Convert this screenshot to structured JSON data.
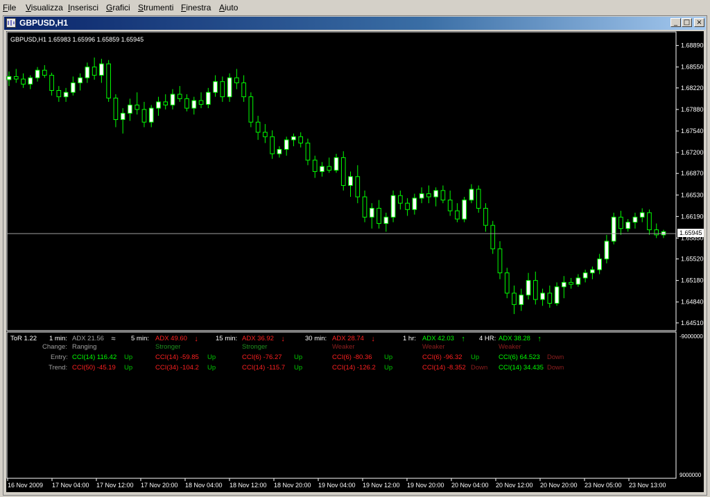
{
  "menu": {
    "items": [
      {
        "label": "File",
        "u": "F",
        "rest": "ile"
      },
      {
        "label": "Visualizza",
        "u": "V",
        "rest": "isualizza"
      },
      {
        "label": "Inserisci",
        "u": "I",
        "rest": "nserisci"
      },
      {
        "label": "Grafici",
        "u": "G",
        "rest": "rafici"
      },
      {
        "label": "Strumenti",
        "u": "S",
        "rest": "trumenti"
      },
      {
        "label": "Finestra",
        "u": "F",
        "rest": "inestra"
      },
      {
        "label": "Aiuto",
        "u": "A",
        "rest": "iuto"
      }
    ]
  },
  "window": {
    "title": "GBPUSD,H1",
    "minimize_label": "_",
    "restore_label": "□",
    "close_label": "×"
  },
  "colors": {
    "background": "#000000",
    "bull": "#ffffff",
    "bear": "#000000",
    "candle_outline": "#00ff00",
    "grid_text": "#ffffff",
    "up": "#00c800",
    "down": "#ff2020",
    "muted_green": "#1f8f1f",
    "muted_red": "#8f1f1f",
    "label_gray": "#a0a0a0",
    "bid_line": "#a0a0a0"
  },
  "chart": {
    "header": "GBPUSD,H1  1.65983 1.65996 1.65859 1.65945",
    "current_price": "1.65945",
    "price_axis": [
      "1.68890",
      "1.68550",
      "1.68220",
      "1.67880",
      "1.67540",
      "1.67200",
      "1.66870",
      "1.66530",
      "1.66190",
      "1.65850",
      "1.65520",
      "1.65180",
      "1.64840",
      "1.64510"
    ],
    "indicator_axis": [
      "-9000000",
      "9000000"
    ],
    "time_axis": [
      "16 Nov 2009",
      "17 Nov 04:00",
      "17 Nov 12:00",
      "17 Nov 20:00",
      "18 Nov 04:00",
      "18 Nov 12:00",
      "18 Nov 20:00",
      "19 Nov 04:00",
      "19 Nov 12:00",
      "19 Nov 20:00",
      "20 Nov 04:00",
      "20 Nov 12:00",
      "20 Nov 20:00",
      "23 Nov 05:00",
      "23 Nov 13:00"
    ]
  },
  "chart_data": {
    "type": "candlestick",
    "symbol": "GBPUSD",
    "timeframe": "H1",
    "ylim": [
      1.6441,
      1.6905
    ],
    "candles": [
      [
        1.6835,
        1.6848,
        1.6825,
        1.684
      ],
      [
        1.684,
        1.6852,
        1.683,
        1.6836
      ],
      [
        1.6836,
        1.6845,
        1.6822,
        1.6828
      ],
      [
        1.6828,
        1.6842,
        1.682,
        1.6838
      ],
      [
        1.6838,
        1.6855,
        1.6832,
        1.685
      ],
      [
        1.685,
        1.6858,
        1.6838,
        1.6842
      ],
      [
        1.6842,
        1.6846,
        1.681,
        1.6818
      ],
      [
        1.6818,
        1.6825,
        1.68,
        1.6808
      ],
      [
        1.6808,
        1.6822,
        1.68,
        1.6815
      ],
      [
        1.6815,
        1.684,
        1.681,
        1.683
      ],
      [
        1.683,
        1.6845,
        1.6818,
        1.6838
      ],
      [
        1.6838,
        1.6862,
        1.683,
        1.6855
      ],
      [
        1.6855,
        1.687,
        1.6835,
        1.6842
      ],
      [
        1.6842,
        1.6868,
        1.683,
        1.686
      ],
      [
        1.686,
        1.6866,
        1.68,
        1.6806
      ],
      [
        1.6806,
        1.6812,
        1.676,
        1.6772
      ],
      [
        1.6772,
        1.679,
        1.675,
        1.6782
      ],
      [
        1.6782,
        1.6805,
        1.677,
        1.6795
      ],
      [
        1.6795,
        1.6815,
        1.678,
        1.6788
      ],
      [
        1.6788,
        1.68,
        1.676,
        1.6768
      ],
      [
        1.6768,
        1.6795,
        1.676,
        1.679
      ],
      [
        1.679,
        1.6808,
        1.6778,
        1.68
      ],
      [
        1.68,
        1.6812,
        1.6788,
        1.6795
      ],
      [
        1.6795,
        1.682,
        1.6788,
        1.6812
      ],
      [
        1.6812,
        1.6825,
        1.68,
        1.6805
      ],
      [
        1.6805,
        1.6812,
        1.6785,
        1.679
      ],
      [
        1.679,
        1.6808,
        1.678,
        1.6802
      ],
      [
        1.6802,
        1.6815,
        1.679,
        1.6796
      ],
      [
        1.6796,
        1.6822,
        1.679,
        1.6815
      ],
      [
        1.6815,
        1.6842,
        1.6808,
        1.6832
      ],
      [
        1.6832,
        1.684,
        1.68,
        1.6808
      ],
      [
        1.6808,
        1.6845,
        1.68,
        1.6838
      ],
      [
        1.6838,
        1.6852,
        1.682,
        1.683
      ],
      [
        1.683,
        1.6842,
        1.68,
        1.6808
      ],
      [
        1.6808,
        1.6815,
        1.676,
        1.6768
      ],
      [
        1.6768,
        1.6778,
        1.674,
        1.6752
      ],
      [
        1.6752,
        1.6765,
        1.6735,
        1.6745
      ],
      [
        1.6745,
        1.6755,
        1.671,
        1.6718
      ],
      [
        1.6718,
        1.673,
        1.6712,
        1.6725
      ],
      [
        1.6725,
        1.6745,
        1.6715,
        1.674
      ],
      [
        1.674,
        1.675,
        1.673,
        1.6745
      ],
      [
        1.6745,
        1.6752,
        1.6728,
        1.6735
      ],
      [
        1.6735,
        1.6742,
        1.67,
        1.6708
      ],
      [
        1.6708,
        1.6715,
        1.668,
        1.669
      ],
      [
        1.669,
        1.6705,
        1.6682,
        1.6698
      ],
      [
        1.6698,
        1.6712,
        1.6688,
        1.6692
      ],
      [
        1.6692,
        1.6718,
        1.6688,
        1.6712
      ],
      [
        1.6712,
        1.6722,
        1.666,
        1.6668
      ],
      [
        1.6668,
        1.669,
        1.665,
        1.6682
      ],
      [
        1.6682,
        1.67,
        1.664,
        1.665
      ],
      [
        1.665,
        1.666,
        1.661,
        1.6618
      ],
      [
        1.6618,
        1.664,
        1.66,
        1.6632
      ],
      [
        1.6632,
        1.6645,
        1.66,
        1.6608
      ],
      [
        1.6608,
        1.6625,
        1.6595,
        1.6618
      ],
      [
        1.6618,
        1.666,
        1.661,
        1.6652
      ],
      [
        1.6652,
        1.666,
        1.663,
        1.664
      ],
      [
        1.664,
        1.6648,
        1.662,
        1.663
      ],
      [
        1.663,
        1.6655,
        1.6622,
        1.6648
      ],
      [
        1.6648,
        1.6665,
        1.664,
        1.6655
      ],
      [
        1.6655,
        1.6668,
        1.664,
        1.665
      ],
      [
        1.665,
        1.6665,
        1.6635,
        1.666
      ],
      [
        1.666,
        1.6668,
        1.664,
        1.6645
      ],
      [
        1.6645,
        1.666,
        1.662,
        1.6628
      ],
      [
        1.6628,
        1.664,
        1.661,
        1.6615
      ],
      [
        1.6615,
        1.665,
        1.661,
        1.6645
      ],
      [
        1.6645,
        1.667,
        1.664,
        1.6662
      ],
      [
        1.6662,
        1.6668,
        1.6625,
        1.6632
      ],
      [
        1.6632,
        1.664,
        1.6595,
        1.6605
      ],
      [
        1.6605,
        1.6612,
        1.656,
        1.6568
      ],
      [
        1.6568,
        1.658,
        1.652,
        1.653
      ],
      [
        1.653,
        1.6538,
        1.649,
        1.6498
      ],
      [
        1.6498,
        1.651,
        1.6465,
        1.648
      ],
      [
        1.648,
        1.6505,
        1.647,
        1.6495
      ],
      [
        1.6495,
        1.653,
        1.6488,
        1.6518
      ],
      [
        1.6518,
        1.6532,
        1.648,
        1.6488
      ],
      [
        1.6488,
        1.6505,
        1.6478,
        1.6498
      ],
      [
        1.6498,
        1.651,
        1.6475,
        1.6482
      ],
      [
        1.6482,
        1.6515,
        1.6478,
        1.6508
      ],
      [
        1.6508,
        1.6525,
        1.649,
        1.6515
      ],
      [
        1.6515,
        1.6522,
        1.6505,
        1.6512
      ],
      [
        1.6512,
        1.6528,
        1.6508,
        1.6522
      ],
      [
        1.6522,
        1.6535,
        1.6515,
        1.653
      ],
      [
        1.653,
        1.654,
        1.652,
        1.6535
      ],
      [
        1.6535,
        1.656,
        1.6528,
        1.6552
      ],
      [
        1.6552,
        1.659,
        1.6545,
        1.658
      ],
      [
        1.658,
        1.6625,
        1.6575,
        1.6618
      ],
      [
        1.6618,
        1.6628,
        1.659,
        1.66
      ],
      [
        1.66,
        1.6615,
        1.6595,
        1.661
      ],
      [
        1.661,
        1.6625,
        1.66,
        1.6618
      ],
      [
        1.6618,
        1.6632,
        1.661,
        1.6625
      ],
      [
        1.6625,
        1.663,
        1.659,
        1.6598
      ],
      [
        1.6598,
        1.6608,
        1.6585,
        1.659
      ],
      [
        1.659,
        1.6598,
        1.6585,
        1.6595
      ]
    ]
  },
  "indicator": {
    "name": "ToR 1.22",
    "change_label": "Change:",
    "entry_label": "Entry:",
    "trend_label": "Trend:",
    "columns": [
      {
        "tf": "1 min:",
        "adx": "ADX 21.56",
        "arrow": "≈",
        "adx_color": "#a0a0a0",
        "arrow_color": "#a0a0a0",
        "change": "Ranging",
        "change_color": "#a0a0a0",
        "entry_cci": "CCI(14) 116.42",
        "entry_cci_color": "#00ff00",
        "entry_dir": "Up",
        "entry_dir_color": "#00c800",
        "trend_cci": "CCI(50) -45.19",
        "trend_cci_color": "#ff2020",
        "trend_dir": "Up",
        "trend_dir_color": "#00c800"
      },
      {
        "tf": "5 min:",
        "adx": "ADX 49.60",
        "arrow": "↓",
        "adx_color": "#ff2020",
        "arrow_color": "#ff2020",
        "change": "Stronger",
        "change_color": "#1f8f1f",
        "entry_cci": "CCI(14) -59.85",
        "entry_cci_color": "#ff2020",
        "entry_dir": "Up",
        "entry_dir_color": "#00c800",
        "trend_cci": "CCI(34) -104.2",
        "trend_cci_color": "#ff2020",
        "trend_dir": "Up",
        "trend_dir_color": "#00c800"
      },
      {
        "tf": "15 min:",
        "adx": "ADX 36.92",
        "arrow": "↓",
        "adx_color": "#ff2020",
        "arrow_color": "#ff2020",
        "change": "Stronger",
        "change_color": "#1f8f1f",
        "entry_cci": "CCI(6) -76.27",
        "entry_cci_color": "#ff2020",
        "entry_dir": "Up",
        "entry_dir_color": "#00c800",
        "trend_cci": "CCI(14) -115.7",
        "trend_cci_color": "#ff2020",
        "trend_dir": "Up",
        "trend_dir_color": "#00c800"
      },
      {
        "tf": "30 min:",
        "adx": "ADX 28.74",
        "arrow": "↓",
        "adx_color": "#ff2020",
        "arrow_color": "#ff2020",
        "change": "Weaker",
        "change_color": "#8f1f1f",
        "entry_cci": "CCI(6) -80.36",
        "entry_cci_color": "#ff2020",
        "entry_dir": "Up",
        "entry_dir_color": "#00c800",
        "trend_cci": "CCI(14) -126.2",
        "trend_cci_color": "#ff2020",
        "trend_dir": "Up",
        "trend_dir_color": "#00c800"
      },
      {
        "tf": "1 hr:",
        "adx": "ADX 42.03",
        "arrow": "↑",
        "adx_color": "#00ff00",
        "arrow_color": "#00ff00",
        "change": "Weaker",
        "change_color": "#8f1f1f",
        "entry_cci": "CCI(6) -96.32",
        "entry_cci_color": "#ff2020",
        "entry_dir": "Up",
        "entry_dir_color": "#00c800",
        "trend_cci": "CCI(14) -8.352",
        "trend_cci_color": "#ff2020",
        "trend_dir": "Down",
        "trend_dir_color": "#8f1f1f"
      },
      {
        "tf": "4 HR:",
        "adx": "ADX 38.28",
        "arrow": "↑",
        "adx_color": "#00ff00",
        "arrow_color": "#00ff00",
        "change": "Weaker",
        "change_color": "#8f1f1f",
        "entry_cci": "CCI(6) 64.523",
        "entry_cci_color": "#00ff00",
        "entry_dir": "Down",
        "entry_dir_color": "#8f1f1f",
        "trend_cci": "CCI(14) 34.435",
        "trend_cci_color": "#00ff00",
        "trend_dir": "Down",
        "trend_dir_color": "#8f1f1f"
      }
    ]
  }
}
